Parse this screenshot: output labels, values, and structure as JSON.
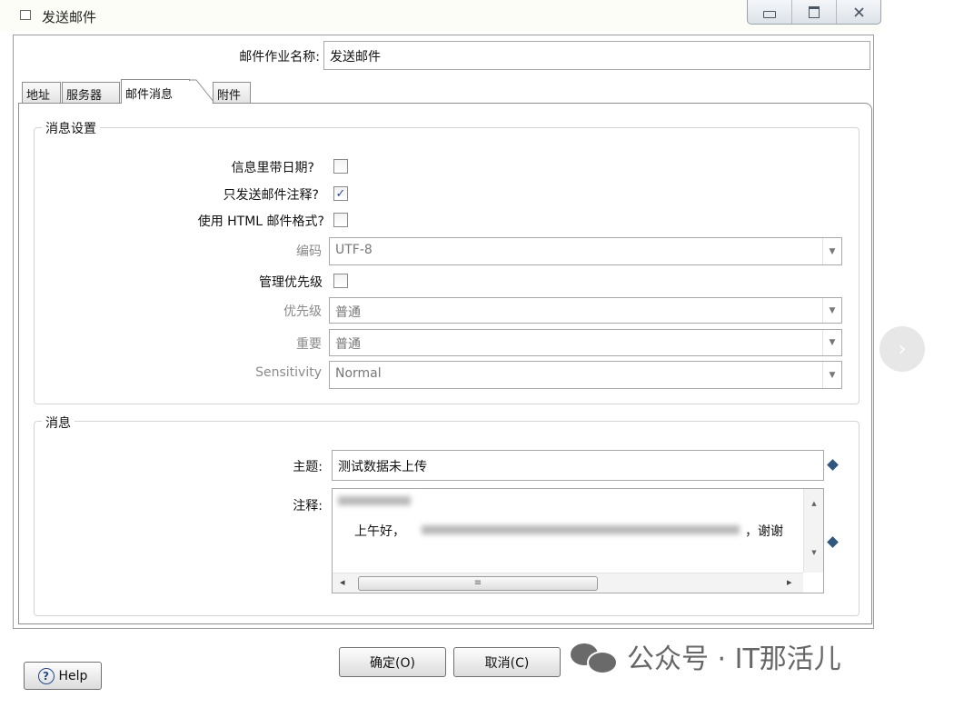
{
  "window": {
    "title": "发送邮件",
    "controls": [
      "minimize-icon",
      "restore-icon",
      "close-icon"
    ]
  },
  "job": {
    "name_label": "邮件作业名称:",
    "name_value": "发送邮件"
  },
  "tabs": [
    {
      "label": "地址",
      "active": false
    },
    {
      "label": "服务器",
      "active": false
    },
    {
      "label": "邮件消息",
      "active": true
    },
    {
      "label": "附件",
      "active": false
    }
  ],
  "message_settings": {
    "title": "消息设置",
    "include_date": {
      "label": "信息里带日期?",
      "checked": false
    },
    "only_comment": {
      "label": "只发送邮件注释?",
      "checked": true,
      "check_glyph": "✓"
    },
    "html_format": {
      "label": "使用 HTML 邮件格式?",
      "checked": false
    },
    "encoding": {
      "label": "编码",
      "value": "UTF-8",
      "enabled": false
    },
    "manage_priority": {
      "label": "管理优先级",
      "checked": false
    },
    "priority": {
      "label": "优先级",
      "value": "普通",
      "enabled": false
    },
    "importance": {
      "label": "重要",
      "value": "普通",
      "enabled": false
    },
    "sensitivity": {
      "label": "Sensitivity",
      "value": "Normal",
      "enabled": false
    }
  },
  "message": {
    "title": "消息",
    "subject_label": "主题:",
    "subject_value": "测试数据未上传",
    "comment_label": "注释:",
    "comment_line2_start": "上午好，",
    "comment_line2_end": "，谢谢",
    "scroll_up": "▲",
    "scroll_down": "▼",
    "scroll_left": "◂",
    "scroll_right": "▸",
    "thumb_grip": "≡"
  },
  "buttons": {
    "help": "Help",
    "ok": "确定(O)",
    "cancel": "取消(C)"
  },
  "watermark": {
    "text": "公众号 · IT那活儿"
  },
  "overlay": {
    "next_glyph": "›"
  },
  "colors": {
    "variable_diamond": "#31577f",
    "check": "#2a4a9a"
  }
}
